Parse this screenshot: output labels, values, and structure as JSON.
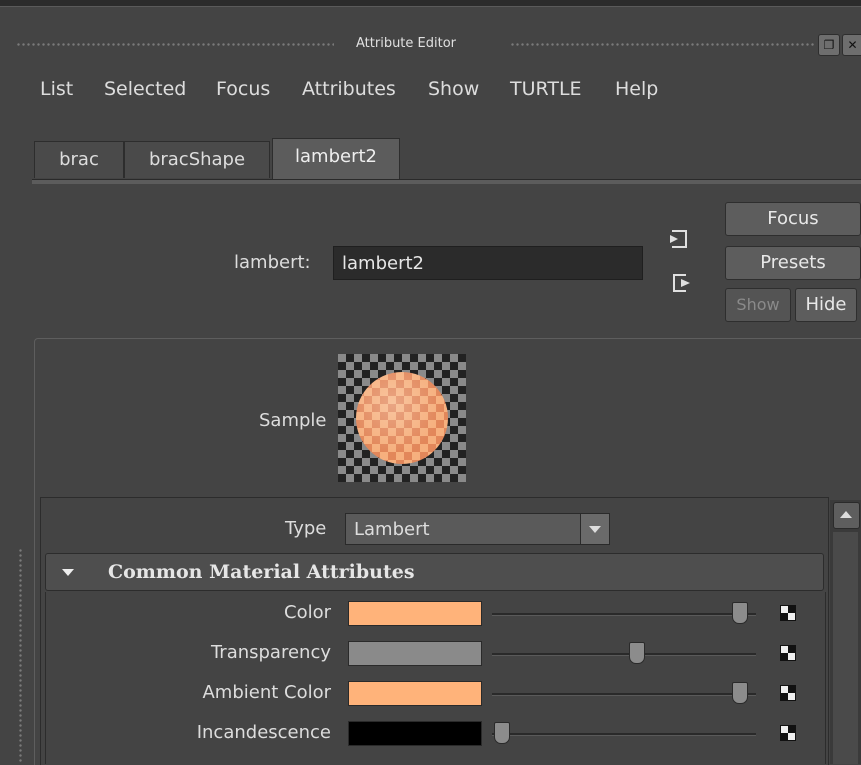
{
  "window": {
    "title": "Attribute Editor"
  },
  "menu": [
    "List",
    "Selected",
    "Focus",
    "Attributes",
    "Show",
    "TURTLE",
    "Help"
  ],
  "tabs": [
    {
      "label": "brac",
      "active": false
    },
    {
      "label": "bracShape",
      "active": false
    },
    {
      "label": "lambert2",
      "active": true
    }
  ],
  "node": {
    "label": "lambert:",
    "value": "lambert2"
  },
  "buttons": {
    "focus": "Focus",
    "presets": "Presets",
    "show": "Show",
    "hide": "Hide"
  },
  "sample": {
    "label": "Sample"
  },
  "type": {
    "label": "Type",
    "value": "Lambert"
  },
  "section": {
    "title": "Common Material Attributes"
  },
  "attributes": [
    {
      "name": "Color",
      "swatch": "#ffb37a",
      "slider": 0.95
    },
    {
      "name": "Transparency",
      "swatch": "#8a8a8a",
      "slider": 0.54
    },
    {
      "name": "Ambient Color",
      "swatch": "#ffb37a",
      "slider": 0.95
    },
    {
      "name": "Incandescence",
      "swatch": "#000000",
      "slider": 0.0
    }
  ]
}
